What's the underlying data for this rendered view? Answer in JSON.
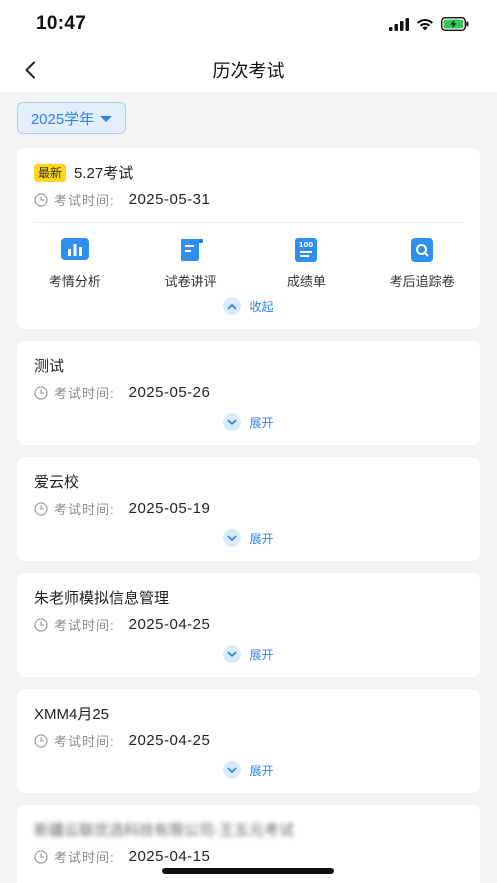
{
  "status_bar": {
    "time": "10:47"
  },
  "header": {
    "title": "历次考试",
    "back_icon": "chevron-left-icon"
  },
  "filter": {
    "year_label": "2025学年"
  },
  "exams": [
    {
      "title": "5.27考试",
      "badge": "最新",
      "time_label": "考试时间:",
      "date": "2025-05-31",
      "expanded": true,
      "toggle_label": "收起",
      "actions": [
        {
          "label": "考情分析",
          "icon": "bar-chart-icon"
        },
        {
          "label": "试卷讲评",
          "icon": "paper-scroll-icon"
        },
        {
          "label": "成绩单",
          "icon": "score-report-icon"
        },
        {
          "label": "考后追踪卷",
          "icon": "search-doc-icon"
        }
      ]
    },
    {
      "title": "测试",
      "time_label": "考试时间:",
      "date": "2025-05-26",
      "toggle_label": "展开"
    },
    {
      "title": "爱云校",
      "time_label": "考试时间:",
      "date": "2025-05-19",
      "toggle_label": "展开"
    },
    {
      "title": "朱老师模拟信息管理",
      "time_label": "考试时间:",
      "date": "2025-04-25",
      "toggle_label": "展开"
    },
    {
      "title": "XMM4月25",
      "time_label": "考试时间:",
      "date": "2025-04-25",
      "toggle_label": "展开"
    },
    {
      "title": "新疆云联优选科技有限公司-王五元考试",
      "time_label": "考试时间:",
      "date": "2025-04-15"
    }
  ],
  "colors": {
    "accent": "#2a84ea",
    "badge": "#ffd51a",
    "background": "#f2f3f5"
  }
}
